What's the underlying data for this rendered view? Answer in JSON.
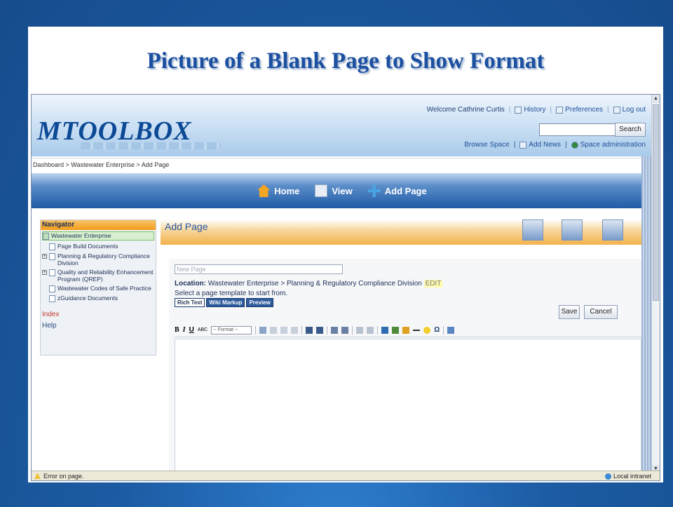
{
  "slide": {
    "title": "Picture of a Blank Page to Show Format"
  },
  "app": {
    "logo": "MTOOLBOX",
    "welcome": "Welcome Cathrine Curtis",
    "history": "History",
    "preferences": "Preferences",
    "logout": "Log out",
    "search_button": "Search",
    "browse_space": "Browse Space",
    "add_news": "Add News",
    "space_admin": "Space administration",
    "breadcrumb": "Dashboard > Wastewater Enterprise > Add Page"
  },
  "nav": {
    "home": "Home",
    "view": "View",
    "add_page": "Add Page"
  },
  "sidebar": {
    "heading": "Navigator",
    "items": [
      {
        "label": "Wastewater Enterprise"
      },
      {
        "label": "Page Build Documents"
      },
      {
        "label": "Planning & Regulatory Compliance Division"
      },
      {
        "label": "Quality and Reliability Enhancement Program (QREP)"
      },
      {
        "label": "Wastewater Codes of Safe Practice"
      },
      {
        "label": "zGuidance Documents"
      }
    ],
    "index": "Index",
    "help": "Help"
  },
  "main": {
    "title": "Add Page",
    "title_placeholder": "New Page",
    "location_label": "Location:",
    "location_value": "Wastewater Enterprise > Planning & Regulatory Compliance Division",
    "edit": "EDIT",
    "template_prompt": "Select a page template to start from.",
    "tabs": [
      "Rich Text",
      "Wiki Markup",
      "Preview"
    ],
    "save": "Save",
    "cancel": "Cancel",
    "format_select": "-- Format --"
  },
  "status": {
    "error": "Error on page.",
    "zone": "Local intranet"
  },
  "colors": {
    "slide_bg": "#1d5fa8",
    "title": "#1b4fa0",
    "orange_band": "#f3b14b",
    "nav_blue": "#1f5ba6"
  }
}
